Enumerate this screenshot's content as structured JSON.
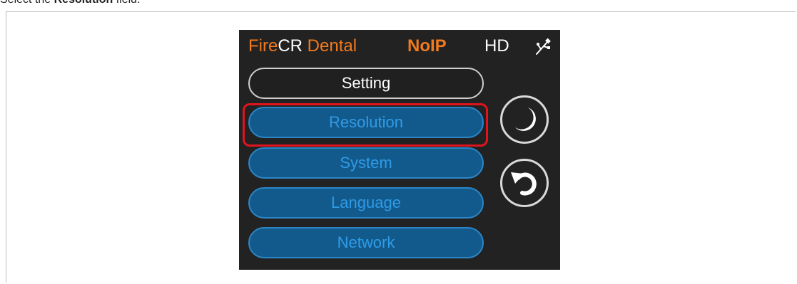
{
  "instruction": {
    "prefix": "Select the ",
    "bold": "Resolution",
    "suffix": " field."
  },
  "statusbar": {
    "fire": "Fire",
    "cr": "CR",
    "dental": " Dental",
    "noip": "NoIP",
    "hd": "HD",
    "usb_icon": "usb-icon"
  },
  "menu": {
    "header": "Setting",
    "items": [
      "Resolution",
      "System",
      "Language",
      "Network"
    ],
    "highlighted": "Resolution"
  },
  "side_buttons": {
    "sleep_icon": "moon-icon",
    "back_icon": "undo-arrow-icon"
  },
  "colors": {
    "accent_orange": "#f07a1e",
    "button_fill": "#135a8c",
    "button_text": "#2f9be6",
    "highlight_red": "#e0141e"
  }
}
